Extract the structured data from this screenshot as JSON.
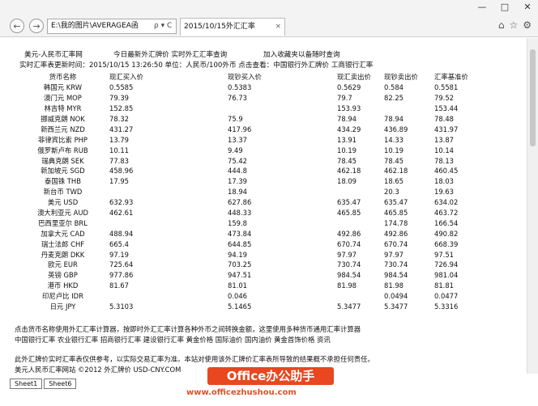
{
  "browser": {
    "address": "E:\\我的图片\\AVERAGEA函",
    "tab_title": "2015/10/15外汇汇率",
    "tab_close": "×",
    "nav_back": "←",
    "nav_forward": "→",
    "addr_tools": "ρ ▾ C",
    "window_buttons": [
      "—",
      "□",
      "✕"
    ],
    "tools": [
      "⌂",
      "☆",
      "⚙"
    ]
  },
  "header": {
    "line1": [
      "美元-人民币汇率网",
      "今日最新外汇牌价 实时外汇汇率查询",
      "加入收藏夹以备随时查询"
    ],
    "line2": "实时汇率表更新时间：2015/10/15 13:26:50  单位：人民币/100外币  点击查看：中国银行外汇牌价 工商银行汇率"
  },
  "table": {
    "headers": [
      "货币名称",
      "现汇买入价",
      "现钞买入价",
      "现汇卖出价",
      "现钞卖出价",
      "汇率基准价"
    ],
    "rows": [
      [
        "韩国元 KRW",
        "0.5585",
        "0.5383",
        "0.5629",
        "0.584",
        "0.5581"
      ],
      [
        "澳门元 MOP",
        "79.39",
        "76.73",
        "79.7",
        "82.25",
        "79.52"
      ],
      [
        "林吉特 MYR",
        "152.85",
        "",
        "153.93",
        "",
        "153.44"
      ],
      [
        "挪威克朗 NOK",
        "78.32",
        "75.9",
        "78.94",
        "78.94",
        "78.48"
      ],
      [
        "新西兰元 NZD",
        "431.27",
        "417.96",
        "434.29",
        "436.89",
        "431.97"
      ],
      [
        "菲律宾比索 PHP",
        "13.79",
        "13.37",
        "13.91",
        "14.33",
        "13.87"
      ],
      [
        "俄罗斯卢布 RUB",
        "10.11",
        "9.49",
        "10.19",
        "10.19",
        "10.14"
      ],
      [
        "瑞典克朗 SEK",
        "77.83",
        "75.42",
        "78.45",
        "78.45",
        "78.13"
      ],
      [
        "新加坡元 SGD",
        "458.96",
        "444.8",
        "462.18",
        "462.18",
        "460.45"
      ],
      [
        "泰国铢 THB",
        "17.95",
        "17.39",
        "18.09",
        "18.65",
        "18.03"
      ],
      [
        "新台币 TWD",
        "",
        "18.94",
        "",
        "20.3",
        "19.63"
      ],
      [
        "美元 USD",
        "632.93",
        "627.86",
        "635.47",
        "635.47",
        "634.02"
      ],
      [
        "澳大利亚元 AUD",
        "462.61",
        "448.33",
        "465.85",
        "465.85",
        "463.72"
      ],
      [
        "巴西里亚尔 BRL",
        "",
        "159.8",
        "",
        "174.78",
        "166.54"
      ],
      [
        "加拿大元 CAD",
        "488.94",
        "473.84",
        "492.86",
        "492.86",
        "490.82"
      ],
      [
        "瑞士法郎 CHF",
        "665.4",
        "644.85",
        "670.74",
        "670.74",
        "668.39"
      ],
      [
        "丹麦克朗 DKK",
        "97.19",
        "94.19",
        "97.97",
        "97.97",
        "97.51"
      ],
      [
        "欧元 EUR",
        "725.64",
        "703.25",
        "730.74",
        "730.74",
        "726.94"
      ],
      [
        "英镑 GBP",
        "977.86",
        "947.51",
        "984.54",
        "984.54",
        "981.04"
      ],
      [
        "港币 HKD",
        "81.67",
        "81.01",
        "81.98",
        "81.98",
        "81.81"
      ],
      [
        "印尼卢比 IDR",
        "",
        "0.046",
        "",
        "0.0494",
        "0.0477"
      ],
      [
        "日元 JPY",
        "5.3103",
        "5.1465",
        "5.3477",
        "5.3477",
        "5.3316"
      ]
    ]
  },
  "notes": {
    "line1": "点击货币名称使用外汇汇率计算器，按即时外汇汇率计算各种外币之间转换金额，这里使用多种货币通用汇率计算器",
    "line2": "中国银行汇率 农业银行汇率 招商银行汇率 建设银行汇率 黄金价格 国际油价 国内油价 黄金首饰价格 资讯",
    "line3": "此外汇牌价实时汇率表仅供参考，以实际交易汇率为准。本站对使用该外汇牌价汇率表所导致的结果概不承担任何责任。",
    "line4": "美元人民币汇率网站 ©2012 外汇牌价 USD-CNY.COM"
  },
  "sheets": [
    "Sheet1",
    "Sheet6"
  ],
  "watermark": {
    "badge": "Office办公助手",
    "url": "www.officezhushou.com"
  }
}
